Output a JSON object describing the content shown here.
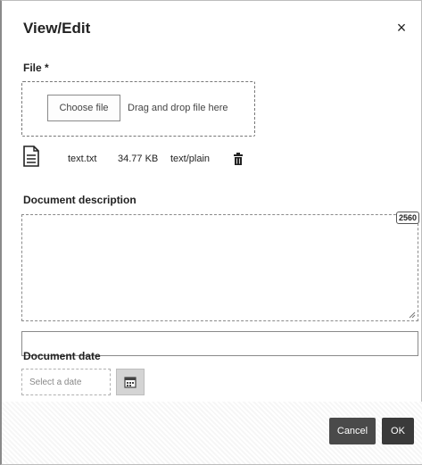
{
  "dialog": {
    "title": "View/Edit",
    "close_label": "×"
  },
  "file_section": {
    "label": "File *",
    "choose_button": "Choose file",
    "drop_text": "Drag and drop file here",
    "file": {
      "name": "text.txt",
      "size": "34.77 KB",
      "type": "text/plain",
      "icon": "document-icon",
      "delete_icon": "trash-icon"
    }
  },
  "description_section": {
    "label": "Document description",
    "value": "",
    "char_counter": "2560"
  },
  "secondary_input": {
    "value": ""
  },
  "date_section": {
    "label": "Document date",
    "placeholder": "Select a date",
    "calendar_icon": "calendar-icon"
  },
  "footer": {
    "cancel_label": "Cancel",
    "ok_label": "OK"
  }
}
